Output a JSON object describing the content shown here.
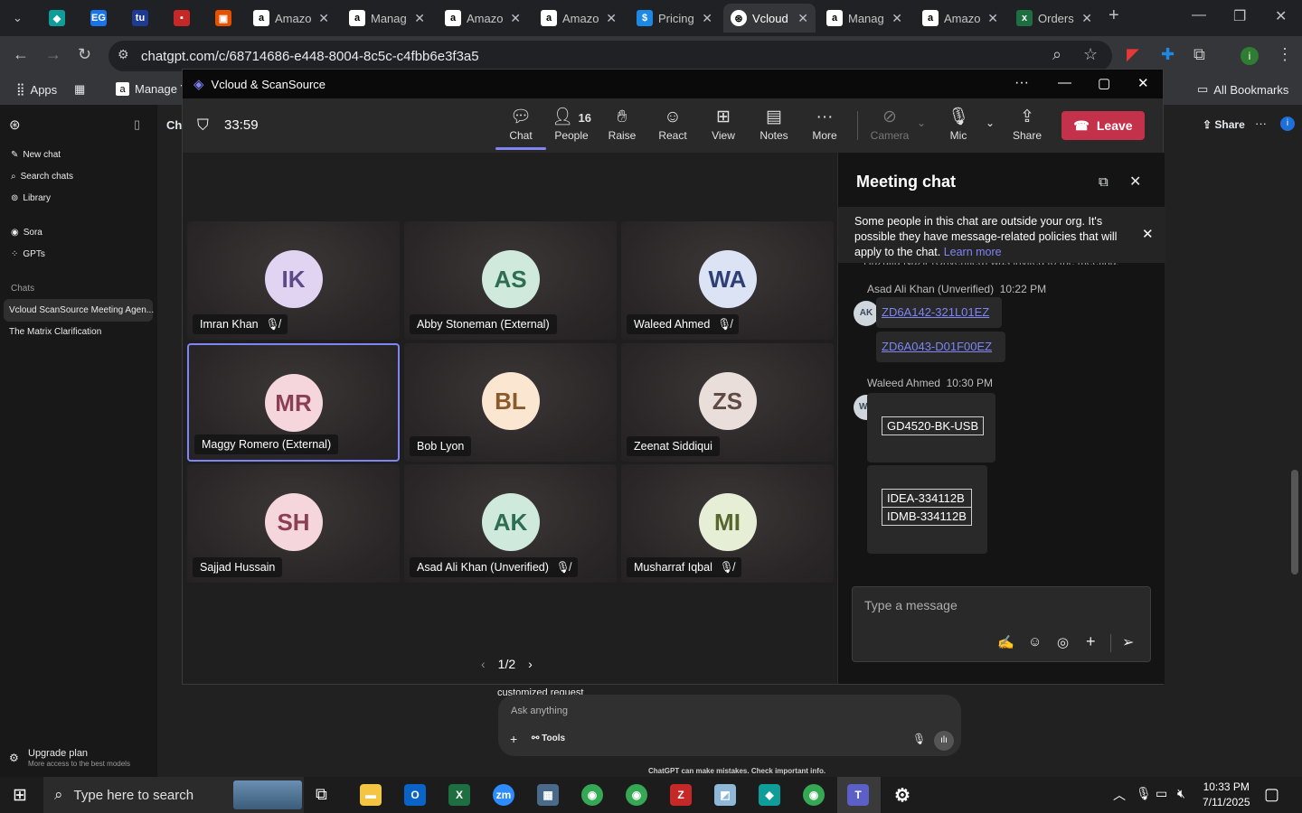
{
  "browser": {
    "tabs": [
      {
        "title": "",
        "icon": "down-chevron-icon",
        "color": "#202124"
      },
      {
        "title": "",
        "icon": "app-icon",
        "color": "#0f9d9a"
      },
      {
        "title": "",
        "icon": "eg-icon",
        "color": "#1a73e8"
      },
      {
        "title": "",
        "icon": "tu-icon",
        "color": "#1f3a93"
      },
      {
        "title": "",
        "icon": "red-icon",
        "color": "#c62828"
      },
      {
        "title": "",
        "icon": "box-icon",
        "color": "#e65100"
      },
      {
        "title": "Amazo",
        "icon": "amazon-icon",
        "color": "#ffffff"
      },
      {
        "title": "Manag",
        "icon": "amazon-icon",
        "color": "#ffffff"
      },
      {
        "title": "Amazo",
        "icon": "amazon-icon",
        "color": "#ffffff"
      },
      {
        "title": "Amazo",
        "icon": "amazon-icon",
        "color": "#ffffff"
      },
      {
        "title": "Pricing",
        "icon": "dollar-icon",
        "color": "#1e88e5"
      },
      {
        "title": "Vcloud",
        "icon": "openai-icon",
        "color": "#ffffff"
      },
      {
        "title": "Manag",
        "icon": "amazon-icon",
        "color": "#ffffff"
      },
      {
        "title": "Amazo",
        "icon": "amazon-icon",
        "color": "#ffffff"
      },
      {
        "title": "Orders",
        "icon": "excel-icon",
        "color": "#1d6f42"
      }
    ],
    "url": "chatgpt.com/c/68714686-e448-8004-8c5c-c4fbb6e3f3a5",
    "bookmarks": {
      "apps": "Apps",
      "manage": "Manage Y",
      "all": "All Bookmarks"
    }
  },
  "chatgpt": {
    "header_fragment": "Cha",
    "share": "Share",
    "menu": [
      "New chat",
      "Search chats",
      "Library"
    ],
    "menu2": [
      "Sora",
      "GPTs"
    ],
    "chats_heading": "Chats",
    "chats": [
      "Vcloud ScanSource Meeting Agen...",
      "The Matrix Clarification"
    ],
    "upgrade_title": "Upgrade plan",
    "upgrade_sub": "More access to the best models",
    "partial_text": "customized request",
    "ask_placeholder": "Ask anything",
    "tools": "Tools",
    "disclaimer": "ChatGPT can make mistakes. Check important info."
  },
  "teams": {
    "window_title": "Vcloud & ScanSource",
    "timer": "33:59",
    "toolbar": {
      "chat": "Chat",
      "people": "People",
      "people_count": "16",
      "raise": "Raise",
      "react": "React",
      "view": "View",
      "notes": "Notes",
      "more": "More",
      "camera": "Camera",
      "mic": "Mic",
      "share": "Share",
      "leave": "Leave"
    },
    "participants": [
      {
        "initials": "IK",
        "name": "Imran Khan",
        "muted": true,
        "bg": "#e0d4f2",
        "fg": "#5b4a86"
      },
      {
        "initials": "AS",
        "name": "Abby Stoneman (External)",
        "muted": false,
        "bg": "#cfe9dc",
        "fg": "#2e6e50"
      },
      {
        "initials": "WA",
        "name": "Waleed Ahmed",
        "muted": true,
        "bg": "#dbe3f4",
        "fg": "#2d3f75"
      },
      {
        "initials": "MR",
        "name": "Maggy Romero (External)",
        "muted": false,
        "bg": "#f4d6dc",
        "fg": "#8a3f52",
        "selected": true
      },
      {
        "initials": "BL",
        "name": "Bob Lyon",
        "muted": false,
        "bg": "#fbe6d2",
        "fg": "#8a5a2b"
      },
      {
        "initials": "ZS",
        "name": "Zeenat Siddiqui",
        "muted": false,
        "bg": "#eadedb",
        "fg": "#5f4a44"
      },
      {
        "initials": "SH",
        "name": "Sajjad Hussain",
        "muted": false,
        "bg": "#f4d6dc",
        "fg": "#8a3f52"
      },
      {
        "initials": "AK",
        "name": "Asad Ali Khan (Unverified)",
        "muted": true,
        "bg": "#cfe9dc",
        "fg": "#2e6e50"
      },
      {
        "initials": "MI",
        "name": "Musharraf Iqbal",
        "muted": true,
        "bg": "#e6efd6",
        "fg": "#55672e"
      }
    ],
    "pager": "1/2",
    "chat": {
      "title": "Meeting chat",
      "banner": "Some people in this chat are outside your org. It's possible they have message-related policies that will apply to the chat.",
      "banner_link": "Learn more",
      "partial_event": "Huzaifa Nazir (Unverified) was invited to the meeting.",
      "messages": [
        {
          "sender": "Asad Ali Khan (Unverified)",
          "time": "10:22 PM",
          "initials": "AK",
          "lines": [
            "ZD6A142-321L01EZ",
            "ZD6A043-D01F00EZ"
          ]
        },
        {
          "sender": "Waleed Ahmed",
          "time": "10:30 PM",
          "initials": "WA",
          "lines": [
            "GD4520-BK-USB",
            "IDEA-334112B",
            "IDMB-334112B"
          ]
        }
      ],
      "placeholder": "Type a message"
    }
  },
  "taskbar": {
    "search_placeholder": "Type here to search",
    "time": "10:33 PM",
    "date": "7/11/2025"
  }
}
